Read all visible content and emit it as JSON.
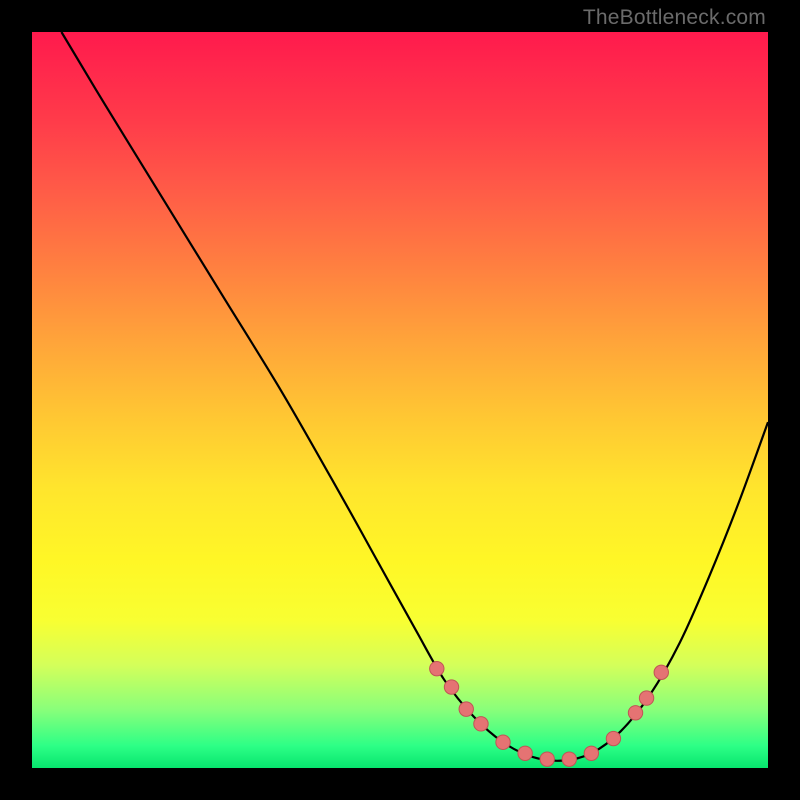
{
  "attribution": "TheBottleneck.com",
  "colors": {
    "page_bg": "#000000",
    "curve": "#000000",
    "marker_fill": "#e57373",
    "marker_stroke": "#c05555"
  },
  "chart_data": {
    "type": "line",
    "title": "",
    "xlabel": "",
    "ylabel": "",
    "xlim": [
      0,
      100
    ],
    "ylim": [
      0,
      100
    ],
    "grid": false,
    "legend": false,
    "series": [
      {
        "name": "curve",
        "x": [
          4,
          10,
          18,
          26,
          34,
          42,
          47,
          52,
          56,
          60,
          64,
          68,
          72,
          76,
          80,
          84,
          88,
          92,
          96,
          100
        ],
        "y": [
          100,
          90,
          77,
          64,
          51,
          37,
          28,
          19,
          12,
          7,
          3.5,
          1.5,
          1,
          2,
          5,
          10,
          17,
          26,
          36,
          47
        ]
      }
    ],
    "markers": [
      {
        "x": 55,
        "y": 13.5
      },
      {
        "x": 57,
        "y": 11
      },
      {
        "x": 59,
        "y": 8
      },
      {
        "x": 61,
        "y": 6
      },
      {
        "x": 64,
        "y": 3.5
      },
      {
        "x": 67,
        "y": 2
      },
      {
        "x": 70,
        "y": 1.2
      },
      {
        "x": 73,
        "y": 1.2
      },
      {
        "x": 76,
        "y": 2
      },
      {
        "x": 79,
        "y": 4
      },
      {
        "x": 82,
        "y": 7.5
      },
      {
        "x": 83.5,
        "y": 9.5
      },
      {
        "x": 85.5,
        "y": 13
      }
    ]
  }
}
